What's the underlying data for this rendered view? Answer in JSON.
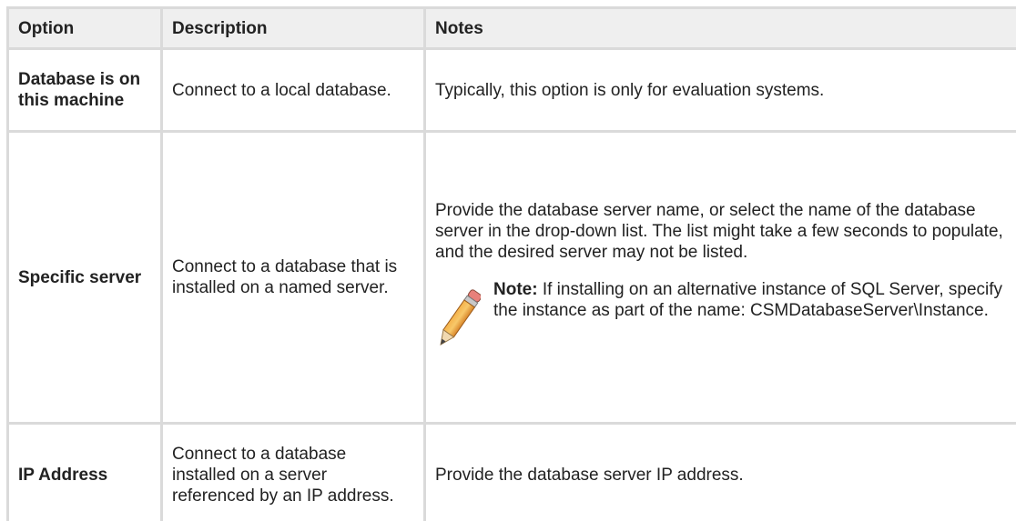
{
  "table": {
    "headers": {
      "option": "Option",
      "description": "Description",
      "notes": "Notes"
    },
    "rows": [
      {
        "option": "Database is on this machine",
        "description": "Connect to a local database.",
        "notes": "Typically, this option is only for evaluation systems."
      },
      {
        "option": "Specific server",
        "description": "Connect to a database that is installed on a named server.",
        "notes": "Provide the database server name, or select the name of the database server in the drop-down list. The list might take a few seconds to populate, and the desired server may not be listed.",
        "note": {
          "icon": "pencil-icon",
          "label": "Note:",
          "text": " If installing on an alternative instance of SQL Server, specify the instance as part of the name: CSMDatabaseServer\\Instance."
        }
      },
      {
        "option": "IP Address",
        "description": "Connect to a database installed on a server referenced by an IP address.",
        "notes": "Provide the database server IP address."
      }
    ]
  },
  "colors": {
    "header_bg": "#efefef",
    "border": "#dadada",
    "text": "#222222"
  }
}
